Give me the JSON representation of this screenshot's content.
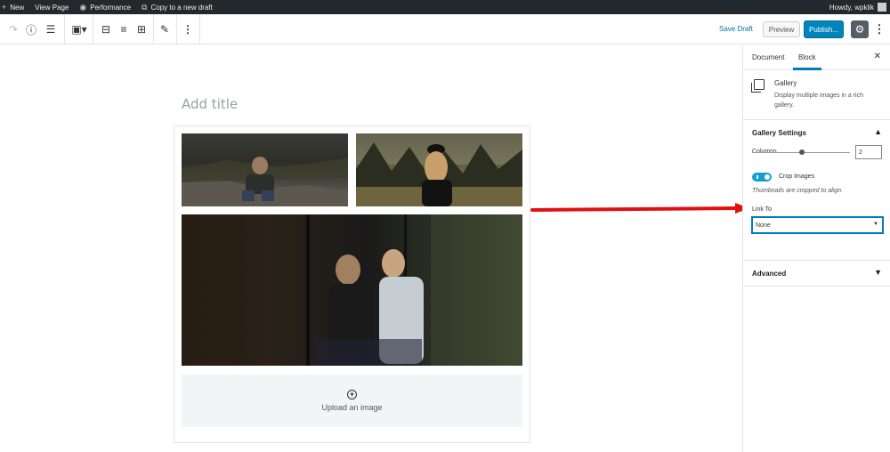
{
  "adminbar": {
    "new": "New",
    "view_page": "View Page",
    "performance": "Performance",
    "copy_draft": "Copy to a new draft",
    "howdy": "Howdy, wpklik"
  },
  "toolbar": {
    "save_draft": "Save Draft",
    "preview": "Preview",
    "publish": "Publish..."
  },
  "editor": {
    "title_placeholder": "Add title",
    "upload_label": "Upload an image"
  },
  "sidebar": {
    "tabs": [
      "Document",
      "Block"
    ],
    "active_tab": "Block",
    "block_name": "Gallery",
    "block_description": "Display multiple images in a rich gallery.",
    "gallery_settings": {
      "title": "Gallery Settings",
      "columns_label": "Columns",
      "columns_value": "2",
      "crop_label": "Crop Images",
      "crop_help": "Thumbnails are cropped to align.",
      "link_to_label": "Link To",
      "link_to_value": "None"
    },
    "advanced": "Advanced"
  },
  "colors": {
    "accent": "#0085ba",
    "admin_bar": "#23282d",
    "toggle_on": "#11a0d2",
    "annotation_arrow": "#e01010"
  }
}
